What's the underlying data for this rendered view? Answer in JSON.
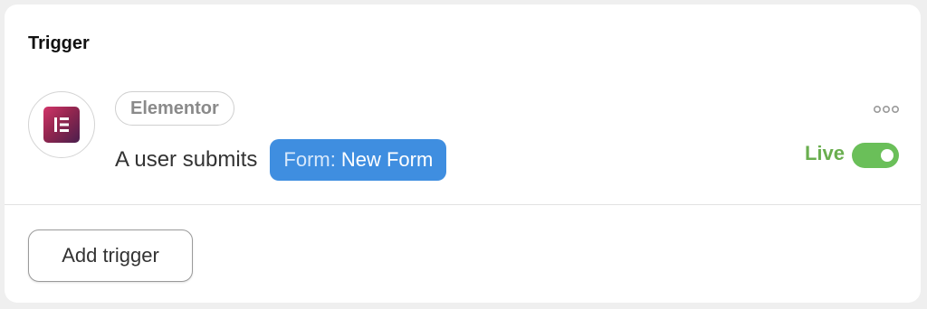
{
  "section": {
    "title": "Trigger"
  },
  "trigger": {
    "app_name": "Elementor",
    "app_icon": "elementor-logo-icon",
    "sentence_prefix": "A user submits",
    "field_key": "Form:",
    "field_value": "New Form",
    "more_icon": "more-dots-icon",
    "status_label": "Live",
    "status_enabled": true
  },
  "actions": {
    "add_trigger_label": "Add trigger"
  },
  "colors": {
    "chip_blue": "#3f8ee0",
    "live_green": "#6aae4f",
    "toggle_green": "#6abf59",
    "elementor_brand": "#93264f"
  }
}
